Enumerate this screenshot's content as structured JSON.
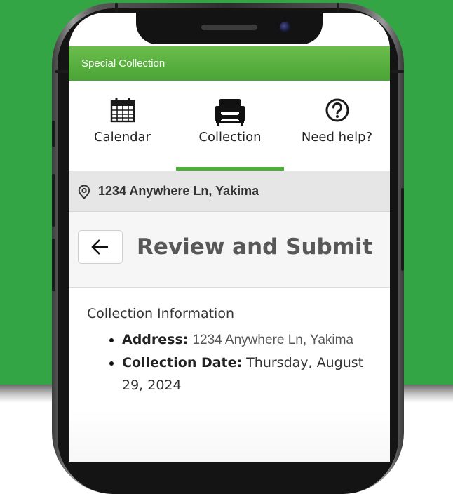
{
  "app": {
    "title": "Special Collection"
  },
  "tabs": [
    {
      "label": "Calendar",
      "icon": "calendar-icon"
    },
    {
      "label": "Collection",
      "icon": "armchair-icon"
    },
    {
      "label": "Need help?",
      "icon": "question-circle-icon"
    }
  ],
  "active_tab": "Collection",
  "address_bar": {
    "address": "1234 Anywhere Ln, Yakima",
    "icon": "location-pin-icon"
  },
  "page": {
    "title": "Review and Submit",
    "back_icon": "arrow-left-icon"
  },
  "collection_info": {
    "heading": "Collection Information",
    "items": [
      {
        "label": "Address:",
        "value": "1234 Anywhere Ln, Yakima"
      },
      {
        "label": "Collection Date:",
        "value": "Thursday, August 29, 2024"
      }
    ]
  },
  "colors": {
    "background": "#34a544",
    "app_bar": "#5cb543",
    "tab_indicator": "#4caf37",
    "title_text": "#585858"
  }
}
